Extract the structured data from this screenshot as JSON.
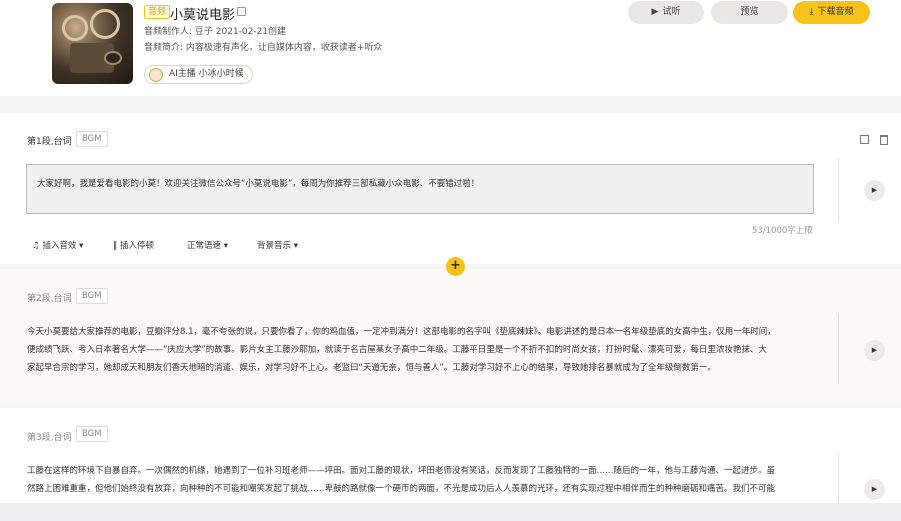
{
  "header": {
    "badge": "音频",
    "title": "小莫说电影",
    "producer": "音频制作人: 豆子 2021-02-21创建",
    "intro": "音频简介: 内容极速有声化，让自媒体内容，收获读者+听众",
    "anchor": "AI主播 小冰小时候",
    "btn_listen": "试听",
    "btn_preview": "预览",
    "btn_download": "下载音频"
  },
  "segments": [
    {
      "title": "第1段,台词",
      "bgm": "BGM",
      "text": "大家好啊，我是爱看电影的小莫！欢迎关注微信公众号“小莫说电影”，每周为你推荐三部私藏小众电影、不要错过啦！",
      "counter": "53/1000字上限",
      "tools": [
        "插入音效",
        "插入停顿",
        "正常语速",
        "背景音乐"
      ]
    },
    {
      "title": "第2段,台词",
      "bgm": "BGM",
      "lines": [
        "今天小莫要给大家推荐的电影，豆瓣评分8.1，毫不夸张的说，只要你看了，你的鸡血值，一定冲到满分！这部电影的名字叫《垫底辣妹》。电影讲述的是日本一名年级垫底的女高中生，仅用一年时间，",
        "便成绩飞跃、考入日本著名大学——“庆应大学”的故事。影片女主工藤沙耶加，就读于名古屋某女子高中二年级。工藤平日里是一个不折不扣的时尚女孩，打扮时髦、漂亮可爱，每日里浓妆艳抹、大",
        "家起早合宗的学习，她却成天和朋友们香天地暗的消遣、娱乐，对学习好不上心。老监曰“天道无亲，恒与善人”。工藤对学习好不上心的结果，导致她排名暴就成为了全年级倒数第一。"
      ]
    },
    {
      "title": "第3段,台词",
      "bgm": "BGM",
      "lines": [
        "工藤在这样的环境下自暴自弃。一次偶然的机缘，她遇到了一位补习班老师——坪田。面对工藤的现状，坪田老师没有笑话，反而发现了工藤独特的一面……随后的一年，他与工藤沟通、一起进步。虽",
        "然路上困难重重，但他们始终没有放弃，向种种的不可能和嘲笑发起了挑战……卑鼓的路就像一个硬币的两面，不光是成功后人人羡慕的光环，还有实现过程中相伴而生的种种磨砺和痛苦。我们不可能"
      ]
    }
  ],
  "add_label": "+",
  "play_label": "▶",
  "colors": {
    "accent": "#f7c21a",
    "badge_border": "#f3c524"
  }
}
